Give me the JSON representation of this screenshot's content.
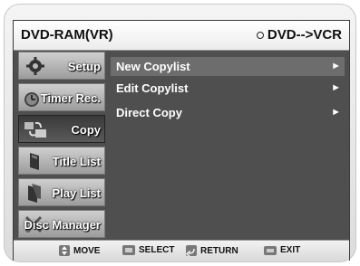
{
  "header": {
    "mode_label": "DVD-RAM(VR)",
    "dub_direction": "DVD-->VCR"
  },
  "sidebar": {
    "items": [
      {
        "label": "Setup",
        "icon": "gear-icon"
      },
      {
        "label": "Timer Rec.",
        "icon": "clock-icon"
      },
      {
        "label": "Copy",
        "icon": "copy-icon",
        "active": true
      },
      {
        "label": "Title List",
        "icon": "title-list-icon"
      },
      {
        "label": "Play List",
        "icon": "play-list-icon"
      },
      {
        "label": "Disc Manager",
        "icon": "disc-manager-icon"
      }
    ]
  },
  "menu": {
    "items": [
      {
        "label": "New Copylist",
        "arrow": "►",
        "selected": true
      },
      {
        "label": "Edit Copylist",
        "arrow": "►"
      },
      {
        "label": "Direct Copy",
        "arrow": "►"
      }
    ]
  },
  "footer": {
    "move": "MOVE",
    "select": "SELECT",
    "return": "RETURN",
    "exit": "EXIT"
  }
}
